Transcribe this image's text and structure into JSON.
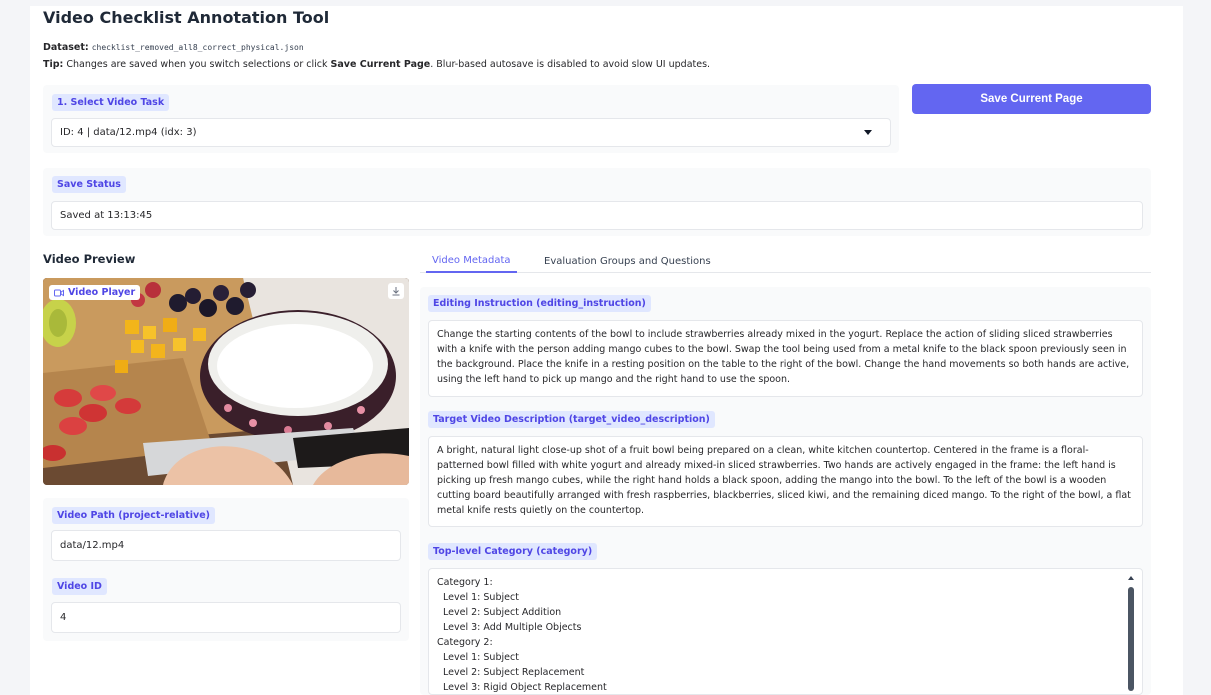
{
  "app": {
    "title": "Video Checklist Annotation Tool",
    "dataset_label": "Dataset:",
    "dataset_value": "checklist_removed_all8_correct_physical.json",
    "tip_label": "Tip:",
    "tip_text_1": " Changes are saved when you switch selections or click ",
    "tip_bold": "Save Current Page",
    "tip_text_2": ". Blur-based autosave is disabled to avoid slow UI updates."
  },
  "select_task": {
    "label": "1. Select Video Task",
    "value": "ID: 4 | data/12.mp4 (idx: 3)"
  },
  "save_button": {
    "label": "Save Current Page"
  },
  "save_status": {
    "label": "Save Status",
    "value": "Saved at 13:13:45"
  },
  "video_preview": {
    "title": "Video Preview",
    "player_label": "Video Player",
    "path_label": "Video Path (project-relative)",
    "path_value": "data/12.mp4",
    "id_label": "Video ID",
    "id_value": "4"
  },
  "tabs": [
    {
      "label": "Video Metadata",
      "active": true
    },
    {
      "label": "Evaluation Groups and Questions",
      "active": false
    }
  ],
  "metadata": {
    "editing_label": "Editing Instruction (editing_instruction)",
    "editing_text": "Change the starting contents of the bowl to include strawberries already mixed in the yogurt. Replace the action of sliding sliced strawberries with a knife with the person adding mango cubes to the bowl. Swap the tool being used from a metal knife to the black spoon previously seen in the background. Place the knife in a resting position on the table to the right of the bowl. Change the hand movements so both hands are active, using the left hand to pick up mango and the right hand to use the spoon.",
    "target_label": "Target Video Description (target_video_description)",
    "target_text": "A bright, natural light close-up shot of a fruit bowl being prepared on a clean, white kitchen countertop. Centered in the frame is a floral-patterned bowl filled with white yogurt and already mixed-in sliced strawberries. Two hands are actively engaged in the frame: the left hand is picking up fresh mango cubes, while the right hand holds a black spoon, adding the mango into the bowl. To the left of the bowl is a wooden cutting board beautifully arranged with fresh raspberries, blackberries, sliced kiwi, and the remaining diced mango. To the right of the bowl, a flat metal knife rests quietly on the countertop.",
    "category_label": "Top-level Category (category)",
    "category_lines": [
      "Category 1:",
      "  Level 1: Subject",
      "  Level 2: Subject Addition",
      "  Level 3: Add Multiple Objects",
      "Category 2:",
      "  Level 1: Subject",
      "  Level 2: Subject Replacement",
      "  Level 3: Rigid Object Replacement"
    ]
  },
  "colors": {
    "accent": "#6366f1",
    "chip_bg": "#e0e7ff",
    "chip_text": "#4f46e5"
  },
  "icons": {
    "dropdown": "caret-down-icon",
    "player": "video-camera-icon",
    "download": "download-icon"
  }
}
